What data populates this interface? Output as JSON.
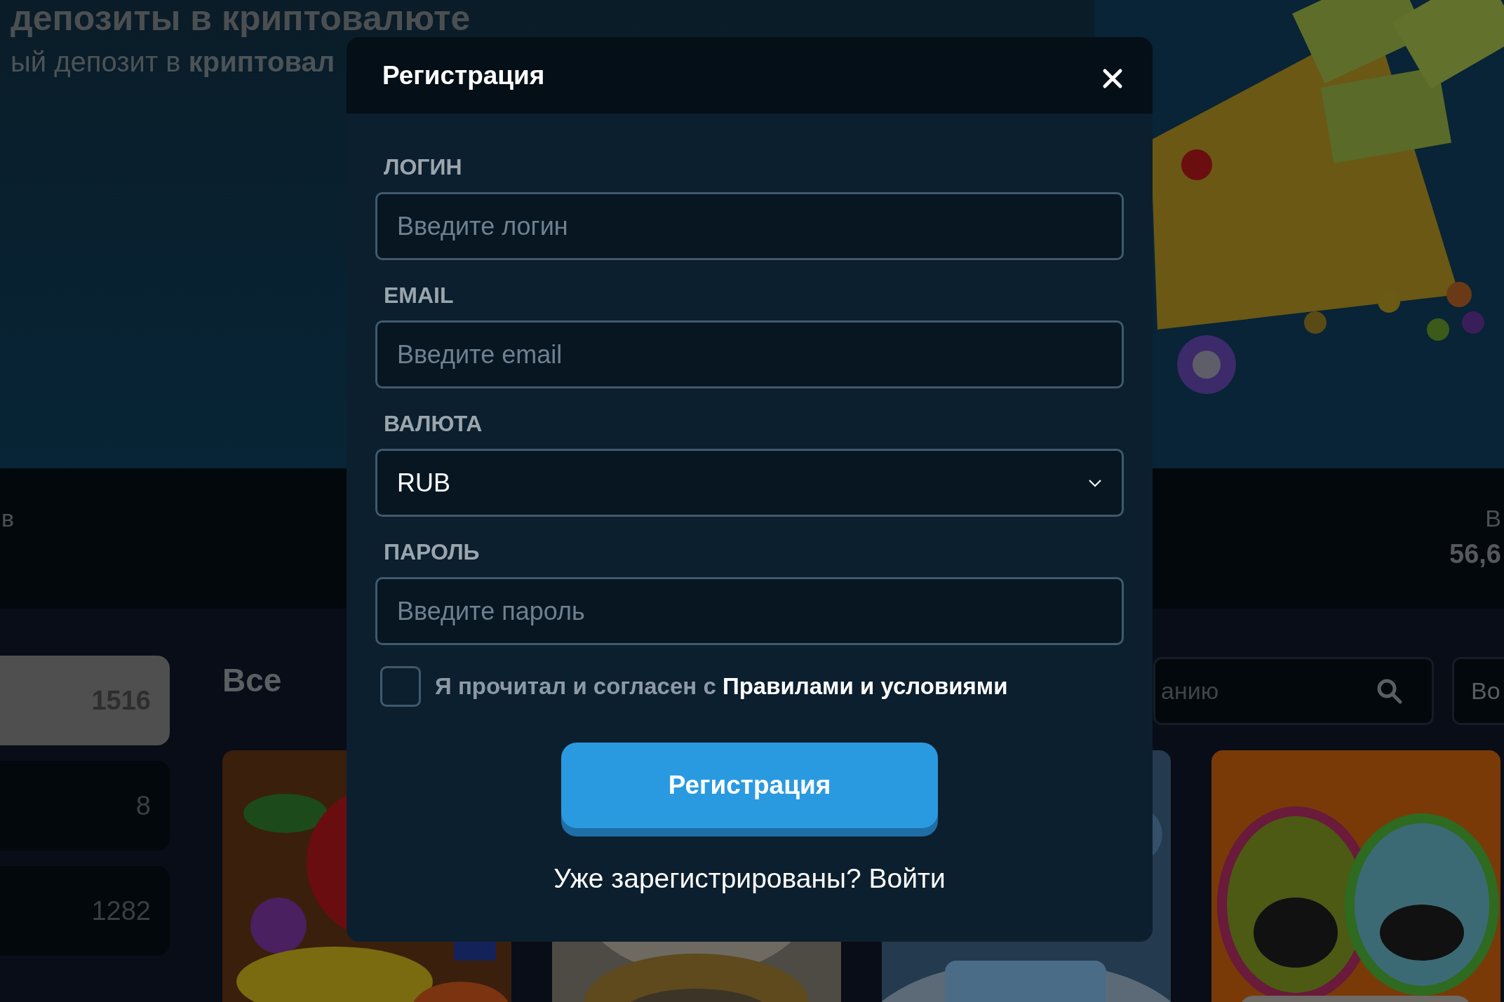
{
  "background": {
    "hero": {
      "title": "депозиты в криптовалюте",
      "subtitle": "ый депозит в **криптовал**",
      "kind": "picture"
    },
    "stats": {
      "left_label": "в",
      "right_label": "В",
      "right_value": "56,6"
    },
    "categories": [
      {
        "count": "1516",
        "selected": true
      },
      {
        "count": "8",
        "selected": false
      },
      {
        "count": "1282",
        "selected": false
      }
    ],
    "section_title": "Все",
    "search": {
      "placeholder": "анию"
    },
    "filter_button": "Во"
  },
  "modal": {
    "title": "Регистрация",
    "fields": [
      {
        "label": "ЛОГИН",
        "kind": "text",
        "placeholder": "Введите логин"
      },
      {
        "label": "EMAIL",
        "kind": "text",
        "placeholder": "Введите email"
      },
      {
        "label": "ВАЛЮТА",
        "kind": "select",
        "value": "RUB"
      },
      {
        "label": "ПАРОЛЬ",
        "kind": "password",
        "placeholder": "Введите пароль"
      }
    ],
    "agreement": {
      "checked": false,
      "text": "Я прочитал и согласен с",
      "link": "Правилами и условиями"
    },
    "submit": "Регистрация",
    "footer": "Уже зарегистрированы? Войти"
  }
}
